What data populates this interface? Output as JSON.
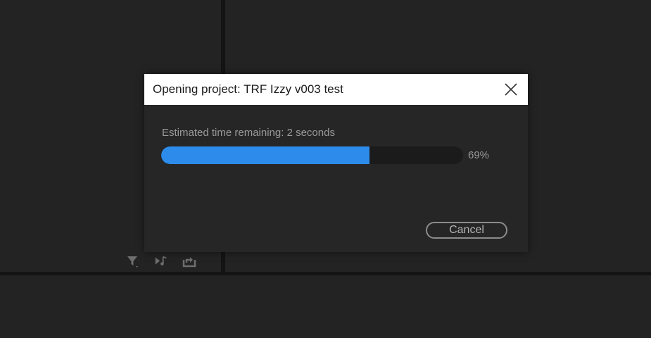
{
  "dialog": {
    "title": "Opening project: TRF Izzy v003 test",
    "eta_text": "Estimated time remaining: 2 seconds",
    "progress_value": 0.69,
    "progress_label": "69%",
    "cancel_label": "Cancel",
    "close_icon": "close-icon"
  },
  "panel_toolbar": {
    "icons": [
      "filter-icon",
      "play-audio-icon",
      "export-icon"
    ]
  },
  "colors": {
    "accent": "#2d8ceb",
    "background": "#232323",
    "dialog_bg": "#262626",
    "titlebar_bg": "#ffffff",
    "muted_text": "#9a9a9a"
  }
}
